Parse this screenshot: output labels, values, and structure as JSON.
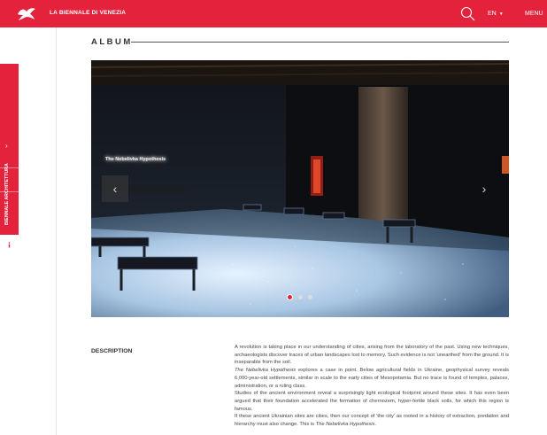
{
  "header": {
    "brand": "LA BIENNALE DI VENEZIA",
    "language": "EN",
    "menu_label": "MENU",
    "logo_icon": "winged-lion-icon",
    "search_icon": "search-icon"
  },
  "sidebar": {
    "tab_label": "BIENNALE ARCHITETTURA",
    "chevron_icon": "chevron-right-icon",
    "info_icon": "info-icon"
  },
  "album": {
    "title": "ALBUM",
    "slide_caption": "The Nebelivka Hypothesis",
    "slide_count": 3,
    "active_slide": 1
  },
  "description": {
    "label": "DESCRIPTION",
    "p1": "A revolution is taking place in our understanding of cities, arising from the laboratory of the past. Using new techniques, archaeologists discover traces of urban landscapes lost to memory. Such evidence is not 'unearthed' from the ground. It is inseparable from the soil.",
    "p2_em": "The Nebelivka Hypothesis",
    "p2_rest": " explores a case in point. Below agricultural fields in Ukraine, geophysical survey reveals 6,000-year-old settlements, similar in scale to the early cities of Mesopotamia. But no trace is found of temples, palaces, administration, or a ruling class.",
    "p3": "Studies of the ancient environment reveal a surprisingly light ecological footprint around these sites. It has even been argued that their foundation accelerated the formation of chernozem, hyper-fertile black soils, for which this region is famous.",
    "p4_start": "If these ancient Ukrainian sites are cities, then our concept of 'the city' as rooted in a history of extraction, predation and hierarchy must also change. This is ",
    "p4_em": "The Nebelivka Hypothesis",
    "p4_end": "."
  },
  "colors": {
    "brand_red": "#e4223c"
  }
}
